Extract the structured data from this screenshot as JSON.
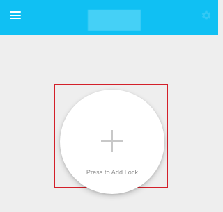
{
  "header": {
    "background_color": "#10c0f3",
    "menu_icon": "hamburger-menu-icon",
    "settings_icon": "gear-icon"
  },
  "main": {
    "add_lock_label": "Press to Add Lock",
    "add_icon": "plus-icon",
    "highlight_color": "#d3202a"
  }
}
